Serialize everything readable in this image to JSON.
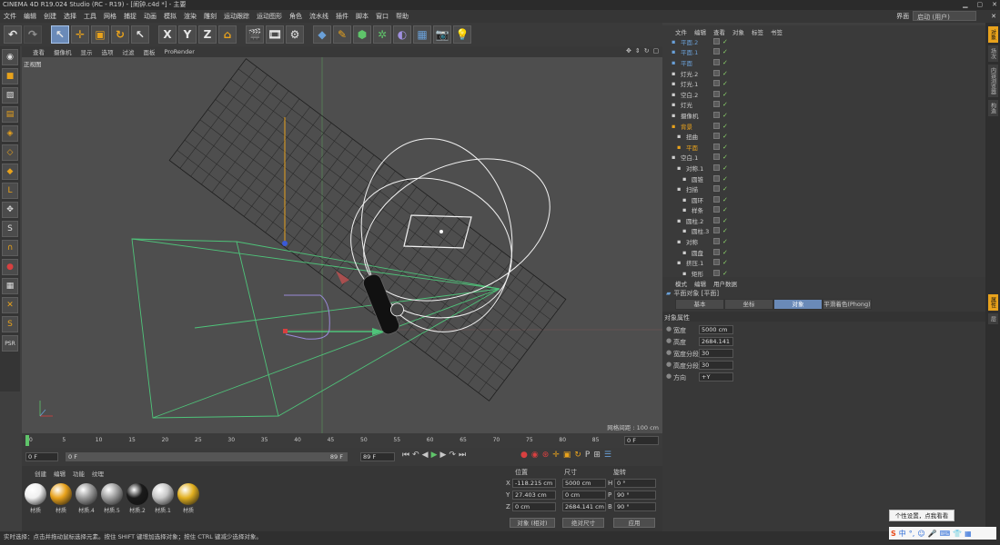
{
  "window": {
    "title": "CINEMA 4D R19.024 Studio (RC - R19) - [闹钟.c4d *] - 主要"
  },
  "menu": [
    "文件",
    "编辑",
    "创建",
    "选择",
    "工具",
    "网格",
    "捕捉",
    "动画",
    "模拟",
    "渲染",
    "雕刻",
    "运动跟踪",
    "运动图形",
    "角色",
    "流水线",
    "插件",
    "脚本",
    "窗口",
    "帮助"
  ],
  "layout": {
    "label": "界面",
    "value": "启动 (用户)"
  },
  "toolbar": {
    "x_label": "X",
    "y_label": "Y",
    "z_label": "Z"
  },
  "viewport": {
    "menu": [
      "查看",
      "摄像机",
      "显示",
      "选项",
      "过滤",
      "面板",
      "ProRender"
    ],
    "name": "正视图",
    "grid_info": "网格间距 : 100 cm"
  },
  "timeline": {
    "ticks": [
      "0",
      "5",
      "10",
      "15",
      "20",
      "25",
      "30",
      "35",
      "40",
      "45",
      "50",
      "55",
      "60",
      "65",
      "70",
      "75",
      "80",
      "85",
      "90"
    ],
    "current": "0 F",
    "start_field": "0 F",
    "range_start": "0 F",
    "range_end": "89 F",
    "end_field": "89 F"
  },
  "materials": {
    "menu": [
      "创建",
      "编辑",
      "功能",
      "纹理"
    ],
    "items": [
      {
        "label": "材质",
        "color": "#f0f0f0"
      },
      {
        "label": "材质",
        "color": "#e8a21c"
      },
      {
        "label": "材质.4",
        "color": "#9a9a9a"
      },
      {
        "label": "材质.5",
        "color": "#a0a0a0"
      },
      {
        "label": "材质.2",
        "color": "#1a1a1a"
      },
      {
        "label": "材质.1",
        "color": "#c8c8c8"
      },
      {
        "label": "材质",
        "color": "#e2b020"
      }
    ]
  },
  "coords": {
    "headers": [
      "位置",
      "尺寸",
      "旋转"
    ],
    "rows": [
      {
        "axis": "X",
        "pos": "-118.215 cm",
        "size": "5000 cm",
        "rot_axis": "H",
        "rot": "0 °"
      },
      {
        "axis": "Y",
        "pos": "27.403 cm",
        "size": "0 cm",
        "rot_axis": "P",
        "rot": "90 °"
      },
      {
        "axis": "Z",
        "pos": "0 cm",
        "size": "2684.141 cm",
        "rot_axis": "B",
        "rot": "90 °"
      }
    ],
    "mode": "对象 (相对)",
    "size_mode": "绝对尺寸",
    "apply": "应用"
  },
  "objects": {
    "menu": [
      "文件",
      "编辑",
      "查看",
      "对象",
      "标签",
      "书签"
    ],
    "rows": [
      {
        "name": "平面.2",
        "indent": 0,
        "color": "#6aa0d8"
      },
      {
        "name": "平面.1",
        "indent": 0,
        "color": "#6aa0d8"
      },
      {
        "name": "平面",
        "indent": 0,
        "color": "#6aa0d8"
      },
      {
        "name": "灯光.2",
        "indent": 0,
        "color": "#cfcfcf"
      },
      {
        "name": "灯光.1",
        "indent": 0,
        "color": "#cfcfcf"
      },
      {
        "name": "空白.2",
        "indent": 0,
        "color": "#cfcfcf"
      },
      {
        "name": "灯光",
        "indent": 0,
        "color": "#cfcfcf"
      },
      {
        "name": "摄像机",
        "indent": 0,
        "color": "#cfcfcf"
      },
      {
        "name": "背景",
        "indent": 0,
        "color": "#e8a21c"
      },
      {
        "name": "扭曲",
        "indent": 1,
        "color": "#cfcfcf"
      },
      {
        "name": "平面",
        "indent": 1,
        "color": "#e8a21c"
      },
      {
        "name": "空白.1",
        "indent": 0,
        "color": "#cfcfcf"
      },
      {
        "name": "对称.1",
        "indent": 1,
        "color": "#cfcfcf"
      },
      {
        "name": "圆锥",
        "indent": 2,
        "color": "#cfcfcf"
      },
      {
        "name": "扫描",
        "indent": 1,
        "color": "#cfcfcf"
      },
      {
        "name": "圆环",
        "indent": 2,
        "color": "#cfcfcf"
      },
      {
        "name": "样条",
        "indent": 2,
        "color": "#cfcfcf"
      },
      {
        "name": "圆柱.2",
        "indent": 1,
        "color": "#cfcfcf"
      },
      {
        "name": "圆柱.3",
        "indent": 2,
        "color": "#cfcfcf"
      },
      {
        "name": "对称",
        "indent": 1,
        "color": "#cfcfcf"
      },
      {
        "name": "圆盘",
        "indent": 2,
        "color": "#cfcfcf"
      },
      {
        "name": "挤压.1",
        "indent": 1,
        "color": "#cfcfcf"
      },
      {
        "name": "矩形",
        "indent": 2,
        "color": "#cfcfcf"
      }
    ]
  },
  "attributes": {
    "menu": [
      "模式",
      "编辑",
      "用户数据"
    ],
    "object_title": "平面对象 [平面]",
    "tabs": [
      "基本",
      "坐标",
      "对象",
      "平滑着色(Phong)"
    ],
    "active_tab": 2,
    "section": "对象属性",
    "props": [
      {
        "label": "宽度",
        "value": "5000 cm"
      },
      {
        "label": "高度",
        "value": "2684.141"
      },
      {
        "label": "宽度分段",
        "value": "30"
      },
      {
        "label": "高度分段",
        "value": "30"
      },
      {
        "label": "方向",
        "value": "+Y"
      }
    ]
  },
  "status": "实时选择：点击并拖动鼠标选择元素。按住 SHIFT 键增加选择对象；按住 CTRL 键减少选择对象。",
  "popup": "个性设置，点我看看",
  "side_tabs": [
    "对象",
    "场次",
    "内容浏览器",
    "构造"
  ],
  "side_tabs2": [
    "属性",
    "层"
  ]
}
